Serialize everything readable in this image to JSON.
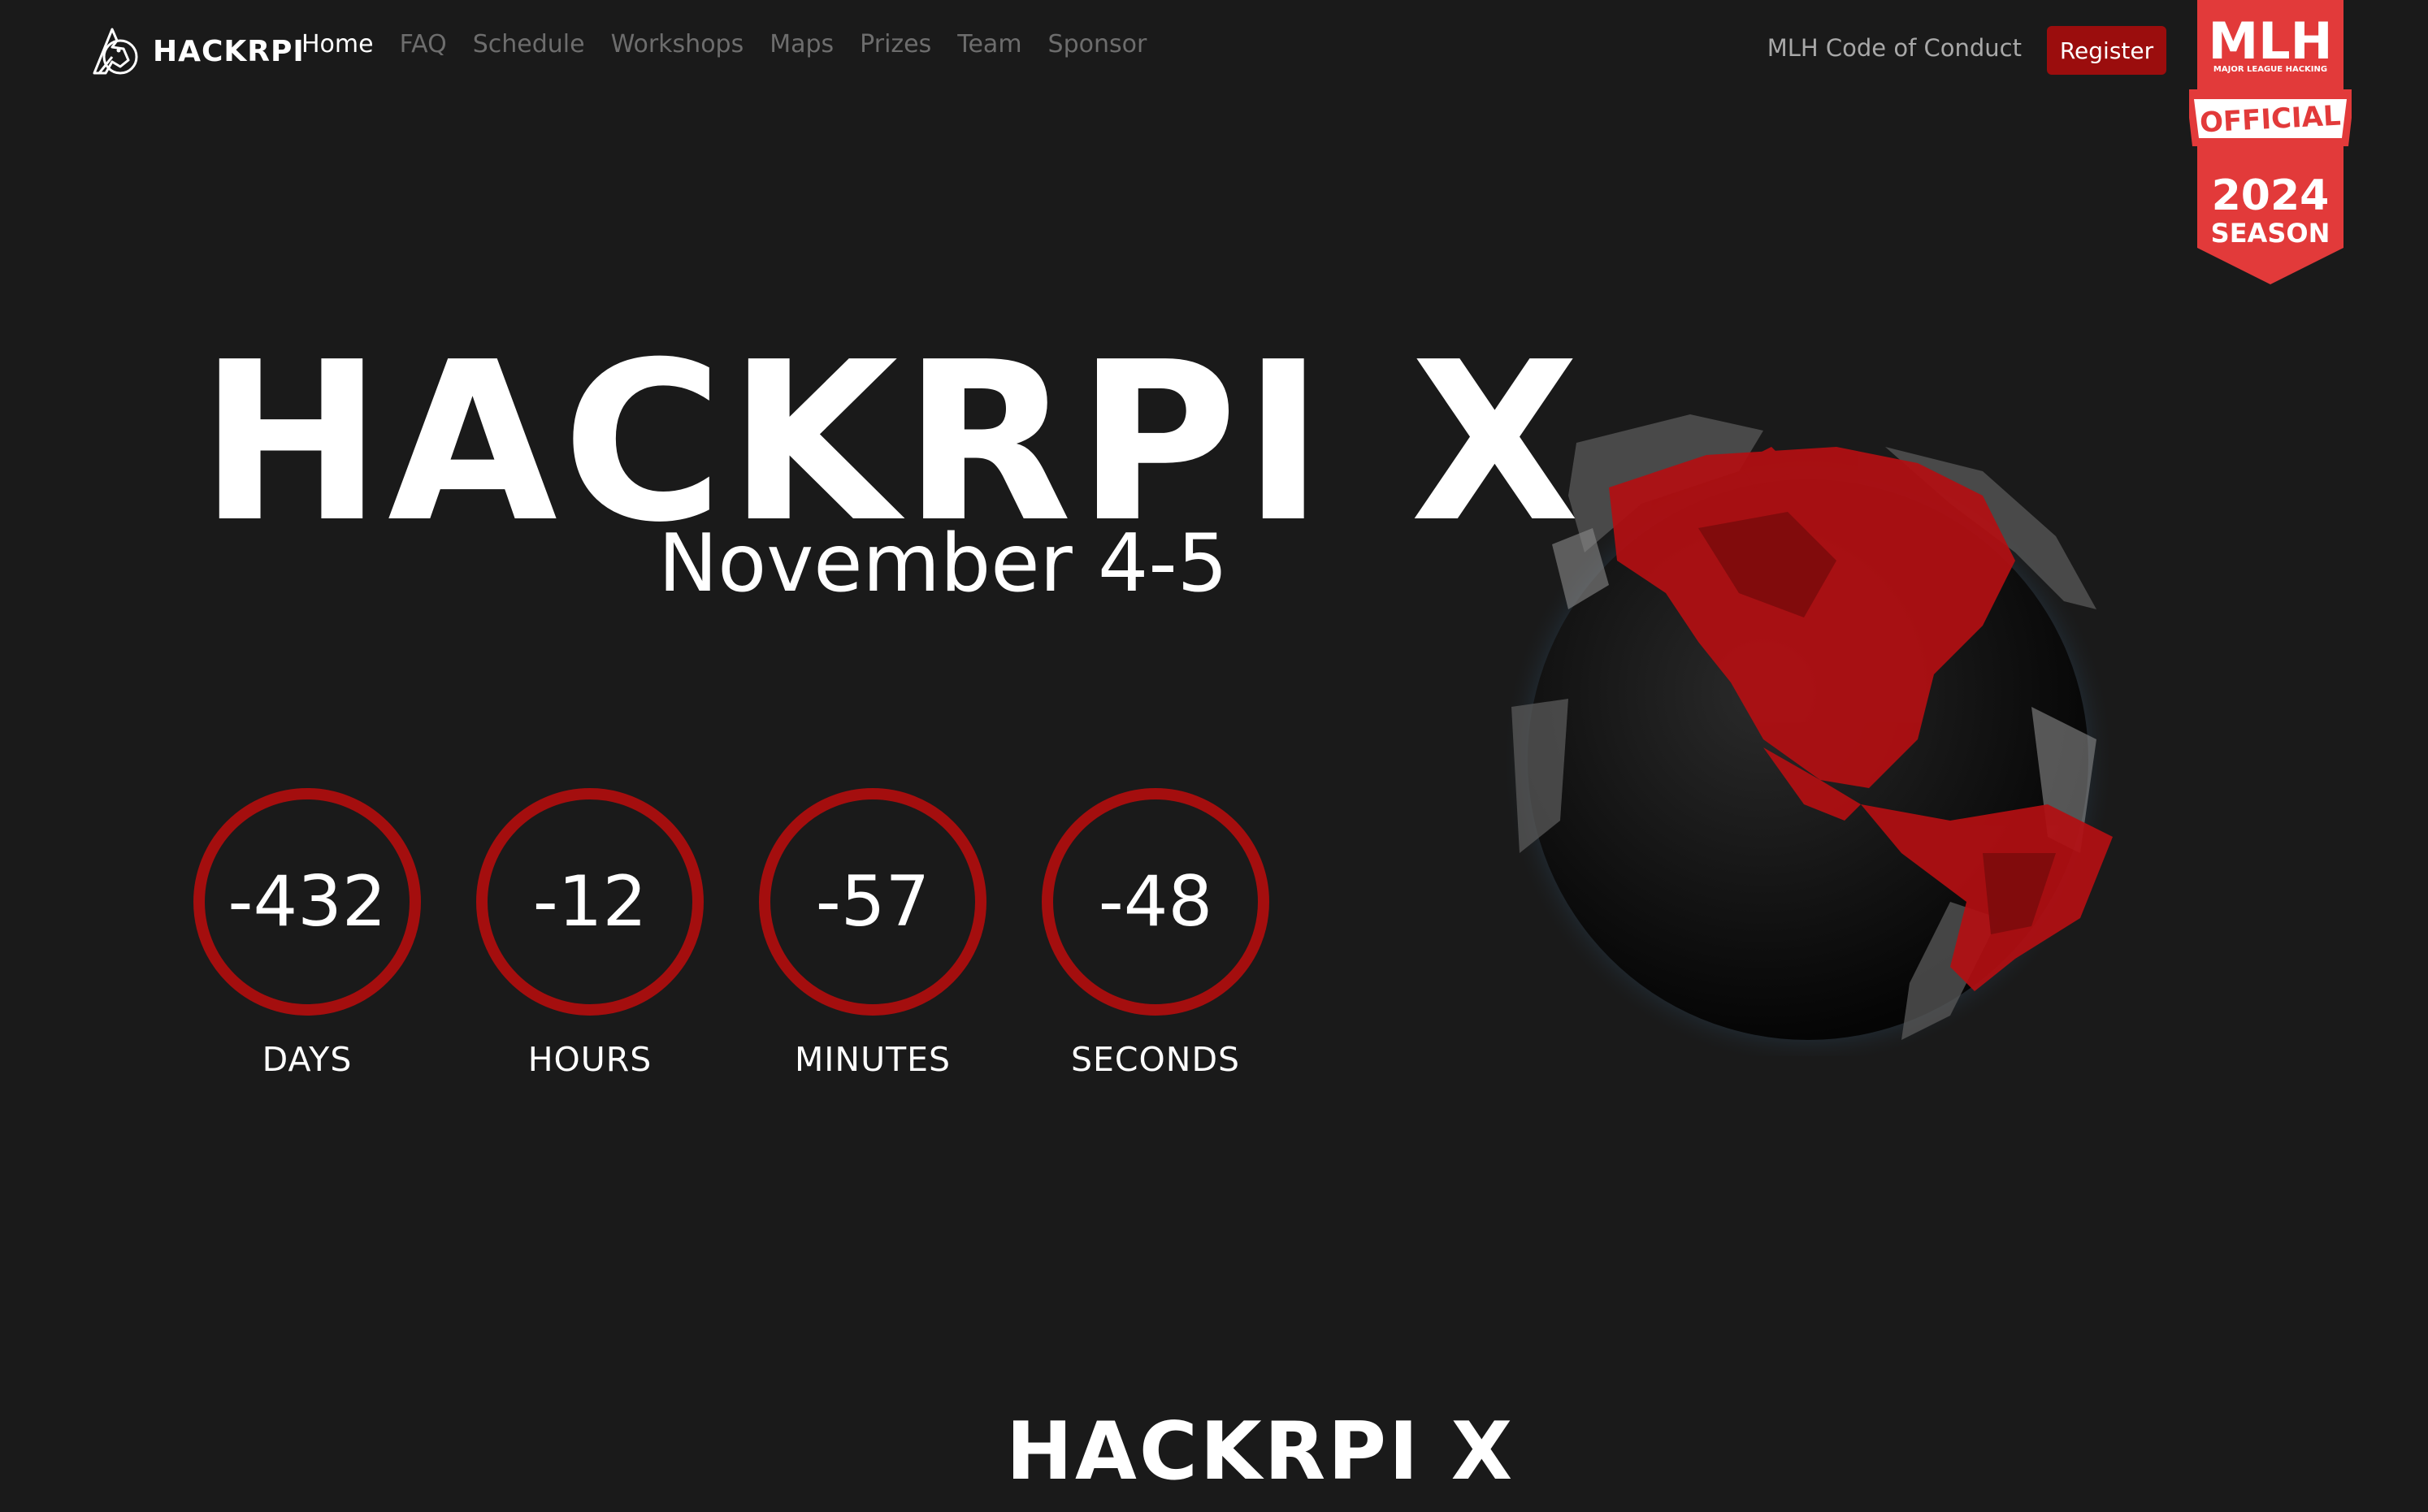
{
  "nav": {
    "brand": "HACKRPI",
    "links": [
      {
        "label": "Home",
        "active": true
      },
      {
        "label": "FAQ",
        "active": false
      },
      {
        "label": "Schedule",
        "active": false
      },
      {
        "label": "Workshops",
        "active": false
      },
      {
        "label": "Maps",
        "active": false
      },
      {
        "label": "Prizes",
        "active": false
      },
      {
        "label": "Team",
        "active": false
      },
      {
        "label": "Sponsor",
        "active": false
      }
    ],
    "code_of_conduct": "MLH Code of Conduct",
    "register": "Register"
  },
  "mlh_badge": {
    "logo": "MLH",
    "tagline": "MAJOR LEAGUE HACKING",
    "official": "OFFICIAL",
    "year": "2024",
    "season": "SEASON"
  },
  "hero": {
    "title": "HACKRPI X",
    "date": "November 4-5"
  },
  "countdown": [
    {
      "value": "-432",
      "label": "DAYS"
    },
    {
      "value": "-12",
      "label": "HOURS"
    },
    {
      "value": "-57",
      "label": "MINUTES"
    },
    {
      "value": "-48",
      "label": "SECONDS"
    }
  ],
  "footer": {
    "title": "HACKRPI X"
  },
  "colors": {
    "background": "#1a1a1a",
    "accent": "#a40e0e",
    "register_button": "#9b0d0d",
    "badge": "#e23a3a"
  },
  "icons": {
    "brand": "hackrpi-horse-logo-icon",
    "globe": "globe-icon"
  }
}
